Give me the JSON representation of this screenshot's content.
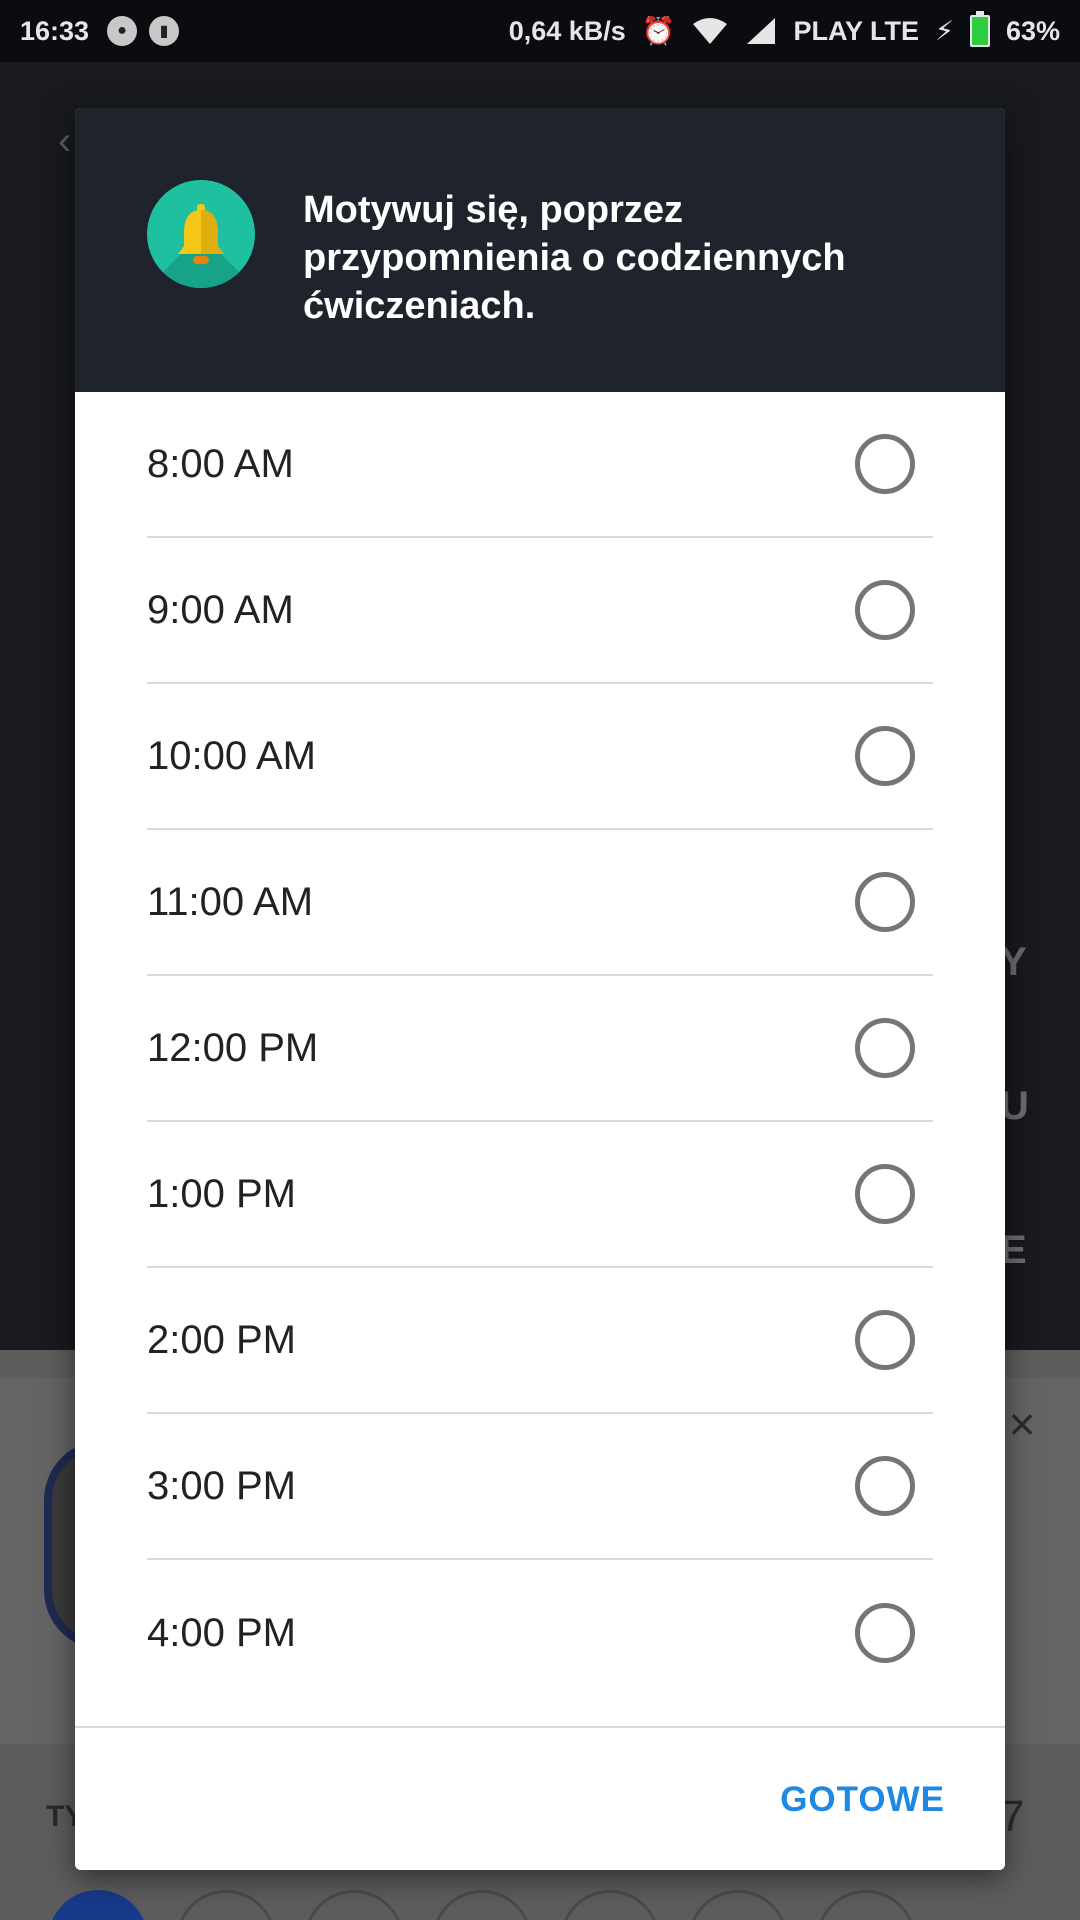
{
  "status_bar": {
    "time": "16:33",
    "speed": "0,64 kB/s",
    "carrier": "PLAY LTE",
    "battery": "63%"
  },
  "dialog": {
    "title": "Motywuj się, poprzez przypomnienia o codziennych ćwiczeniach.",
    "options": [
      {
        "label": "8:00 AM",
        "selected": false
      },
      {
        "label": "9:00 AM",
        "selected": false
      },
      {
        "label": "10:00 AM",
        "selected": false
      },
      {
        "label": "11:00 AM",
        "selected": false
      },
      {
        "label": "12:00 PM",
        "selected": false
      },
      {
        "label": "1:00 PM",
        "selected": false
      },
      {
        "label": "2:00 PM",
        "selected": false
      },
      {
        "label": "3:00 PM",
        "selected": false
      },
      {
        "label": "4:00 PM",
        "selected": false
      }
    ],
    "done_label": "GOTOWE"
  },
  "colors": {
    "header_bg": "#1f232c",
    "accent": "#1e88e5",
    "bell_badge": "#1ec0a0",
    "bell": "#f5c518"
  }
}
